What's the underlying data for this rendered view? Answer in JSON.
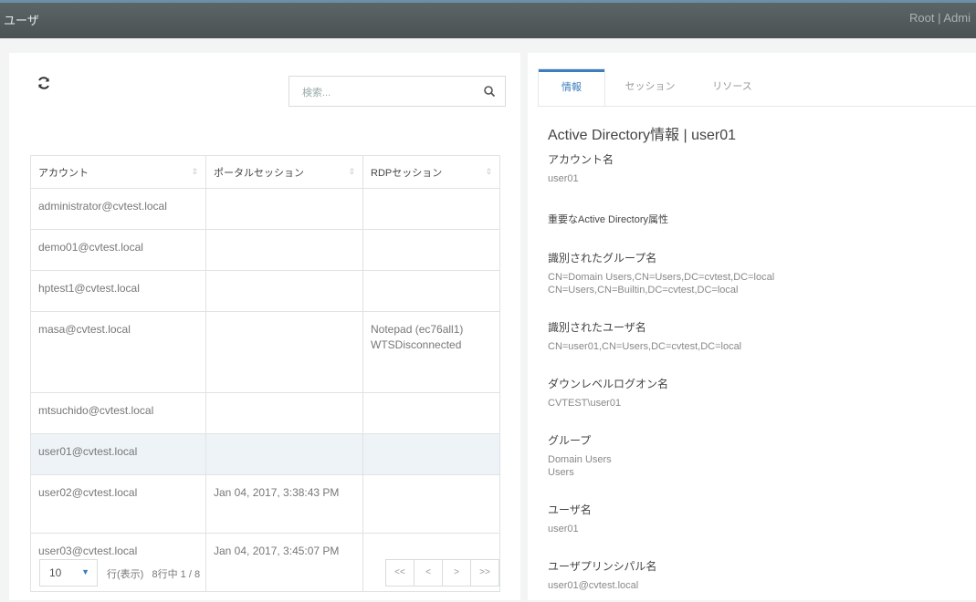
{
  "header": {
    "title": "ユーザ",
    "user": "Root | Admi"
  },
  "search": {
    "placeholder": "検索..."
  },
  "table": {
    "columns": [
      "アカウント",
      "ポータルセッション",
      "RDPセッション"
    ],
    "rows": [
      {
        "account": "administrator@cvtest.local",
        "portal": "",
        "rdp": ""
      },
      {
        "account": "demo01@cvtest.local",
        "portal": "",
        "rdp": ""
      },
      {
        "account": "hptest1@cvtest.local",
        "portal": "",
        "rdp": ""
      },
      {
        "account": "masa@cvtest.local",
        "portal": "",
        "rdp": "Notepad (ec76all1)\nWTSDisconnected"
      },
      {
        "account": "mtsuchido@cvtest.local",
        "portal": "",
        "rdp": ""
      },
      {
        "account": "user01@cvtest.local",
        "portal": "",
        "rdp": ""
      },
      {
        "account": "user02@cvtest.local",
        "portal": "Jan 04, 2017, 3:38:43 PM",
        "rdp": ""
      },
      {
        "account": "user03@cvtest.local",
        "portal": "Jan 04, 2017, 3:45:07 PM",
        "rdp": ""
      }
    ]
  },
  "pager": {
    "page_size": "10",
    "rows_label": "行(表示)",
    "info": "8行中 1 / 8",
    "buttons": [
      "<<",
      "<",
      ">",
      ">>"
    ]
  },
  "tabs": [
    "情報",
    "セッション",
    "リソース"
  ],
  "info": {
    "title": "Active Directory情報 | user01",
    "account_label": "アカウント名",
    "account_value": "user01",
    "attributes_heading": "重要なActive Directory属性",
    "group_dn_label": "識別されたグループ名",
    "group_dn_value": "CN=Domain Users,CN=Users,DC=cvtest,DC=local\nCN=Users,CN=Builtin,DC=cvtest,DC=local",
    "user_dn_label": "識別されたユーザ名",
    "user_dn_value": "CN=user01,CN=Users,DC=cvtest,DC=local",
    "downlevel_label": "ダウンレベルログオン名",
    "downlevel_value": "CVTEST\\user01",
    "group_label": "グループ",
    "group_value": "Domain Users\nUsers",
    "username_label": "ユーザ名",
    "username_value": "user01",
    "upn_label": "ユーザプリンシパル名",
    "upn_value": "user01@cvtest.local"
  },
  "colors": {
    "accent": "#3b7dbd",
    "topbar": "#4f5758",
    "selected_row": "#eef3f7"
  }
}
